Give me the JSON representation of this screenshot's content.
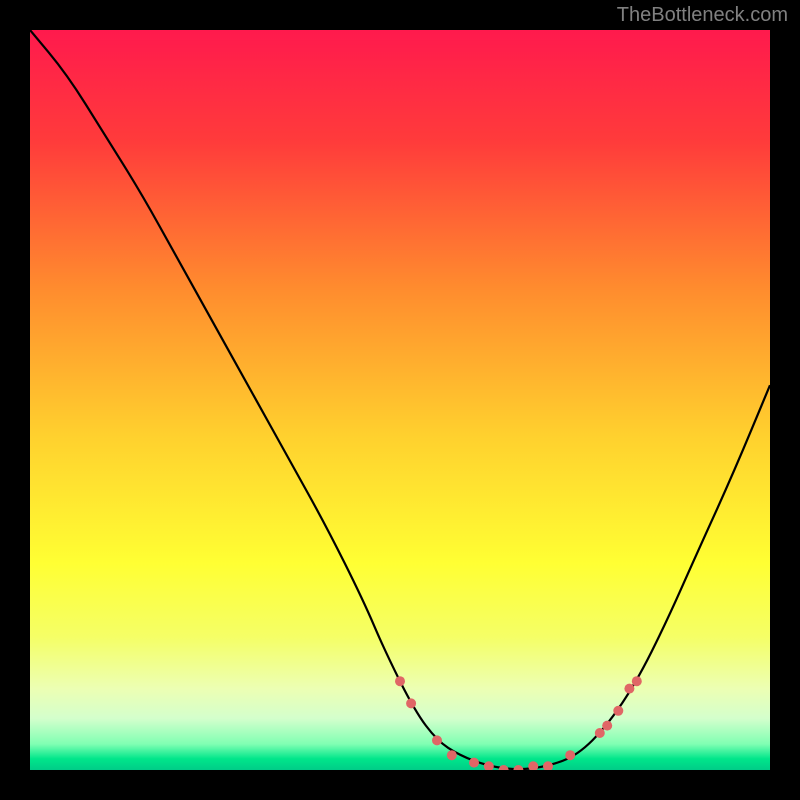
{
  "watermark": "TheBottleneck.com",
  "chart_data": {
    "type": "line",
    "title": "",
    "xlabel": "",
    "ylabel": "",
    "xlim": [
      0,
      100
    ],
    "ylim": [
      0,
      100
    ],
    "background_gradient": {
      "stops": [
        {
          "offset": 0,
          "color": "#ff1a4d"
        },
        {
          "offset": 0.15,
          "color": "#ff3b3b"
        },
        {
          "offset": 0.35,
          "color": "#ff8c2e"
        },
        {
          "offset": 0.55,
          "color": "#ffd12e"
        },
        {
          "offset": 0.72,
          "color": "#ffff33"
        },
        {
          "offset": 0.82,
          "color": "#f5ff66"
        },
        {
          "offset": 0.89,
          "color": "#ecffb3"
        },
        {
          "offset": 0.93,
          "color": "#d4ffcc"
        },
        {
          "offset": 0.965,
          "color": "#80ffb3"
        },
        {
          "offset": 0.985,
          "color": "#00e68a"
        },
        {
          "offset": 1.0,
          "color": "#00cc88"
        }
      ]
    },
    "series": [
      {
        "name": "bottleneck-curve",
        "color": "#000000",
        "x": [
          0,
          5,
          10,
          15,
          20,
          25,
          30,
          35,
          40,
          45,
          48,
          52,
          55,
          58,
          62,
          66,
          70,
          74,
          78,
          82,
          86,
          90,
          95,
          100
        ],
        "y": [
          100,
          94,
          86,
          78,
          69,
          60,
          51,
          42,
          33,
          23,
          16,
          8,
          4,
          2,
          0.5,
          0,
          0.5,
          2,
          6,
          12,
          20,
          29,
          40,
          52
        ]
      }
    ],
    "markers": {
      "name": "highlight-points",
      "color": "#e06666",
      "radius": 5,
      "points": [
        {
          "x": 50,
          "y": 12
        },
        {
          "x": 51.5,
          "y": 9
        },
        {
          "x": 55,
          "y": 4
        },
        {
          "x": 57,
          "y": 2
        },
        {
          "x": 60,
          "y": 1
        },
        {
          "x": 62,
          "y": 0.5
        },
        {
          "x": 64,
          "y": 0
        },
        {
          "x": 66,
          "y": 0
        },
        {
          "x": 68,
          "y": 0.5
        },
        {
          "x": 70,
          "y": 0.5
        },
        {
          "x": 73,
          "y": 2
        },
        {
          "x": 77,
          "y": 5
        },
        {
          "x": 78,
          "y": 6
        },
        {
          "x": 79.5,
          "y": 8
        },
        {
          "x": 81,
          "y": 11
        },
        {
          "x": 82,
          "y": 12
        }
      ]
    }
  }
}
